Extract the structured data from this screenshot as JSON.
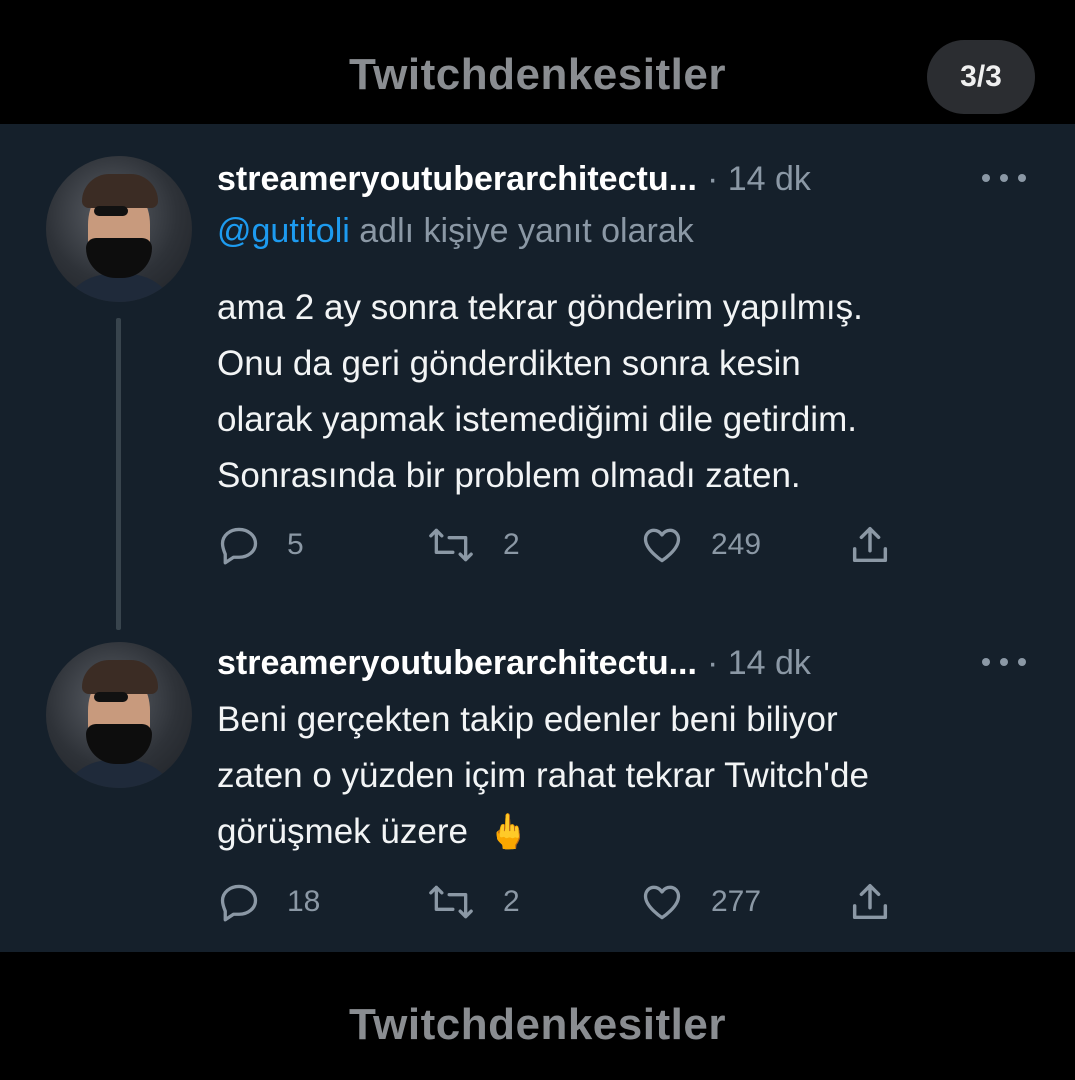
{
  "watermark": {
    "top": "Twitchdenkesitler",
    "bottom": "Twitchdenkesitler"
  },
  "page_indicator": "3/3",
  "colors": {
    "background": "#15202b",
    "link": "#1d9bf0",
    "muted": "#8b98a5",
    "text": "#f2f4f5"
  },
  "tweets": [
    {
      "author": "streameryoutuberarchitectu...",
      "time": "· 14 dk",
      "reply_handle": "@gutitoli",
      "reply_suffix": "adlı kişiye yanıt olarak",
      "lines": [
        "ama 2 ay sonra tekrar gönderim yapılmış.",
        "Onu da geri gönderdikten sonra kesin",
        "olarak yapmak istemediğimi dile getirdim.",
        "Sonrasında bir problem olmadı zaten."
      ],
      "replies": "5",
      "retweets": "2",
      "likes": "249"
    },
    {
      "author": "streameryoutuberarchitectu...",
      "time": "· 14 dk",
      "lines": [
        "Beni gerçekten takip edenler beni biliyor",
        "zaten o yüzden içim rahat tekrar Twitch'de",
        "görüşmek üzere"
      ],
      "emoji": "🖕",
      "replies": "18",
      "retweets": "2",
      "likes": "277"
    }
  ],
  "icons": [
    "reply-icon",
    "retweet-icon",
    "like-icon",
    "share-icon",
    "more-icon"
  ]
}
